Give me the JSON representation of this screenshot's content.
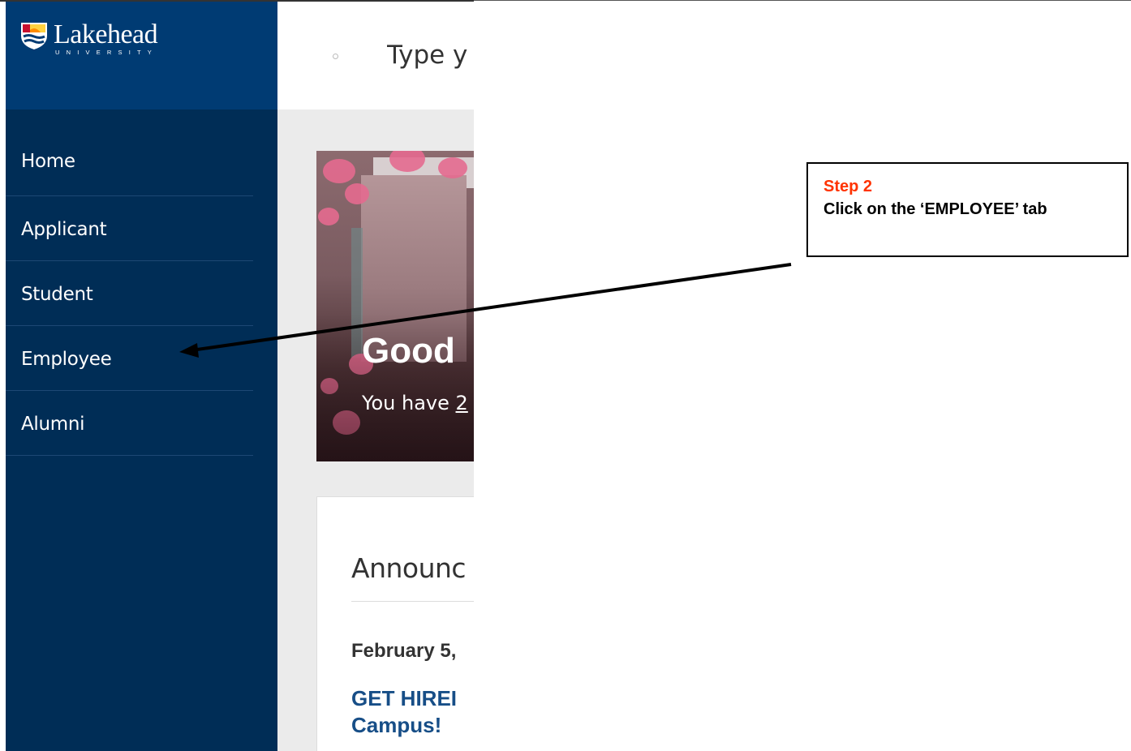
{
  "brand": {
    "name": "Lakehead",
    "subtitle": "UNIVERSITY"
  },
  "search": {
    "placeholder": "Type y"
  },
  "sidebar": {
    "items": [
      {
        "label": "Home"
      },
      {
        "label": "Applicant"
      },
      {
        "label": "Student"
      },
      {
        "label": "Employee"
      },
      {
        "label": "Alumni"
      }
    ]
  },
  "hero": {
    "greeting": "Good",
    "notice_prefix": "You have ",
    "notice_link": "2"
  },
  "announcements": {
    "title": "Announc",
    "date": "February 5,",
    "headline_line1": "GET HIREI",
    "headline_line2": "Campus!"
  },
  "callout": {
    "step": "Step 2",
    "text": "Click on the ‘EMPLOYEE’ tab"
  },
  "colors": {
    "sidebar_bg": "#002d56",
    "logo_bar_bg": "#003b73",
    "step_label": "#ff3300",
    "headline_link": "#174e87"
  }
}
